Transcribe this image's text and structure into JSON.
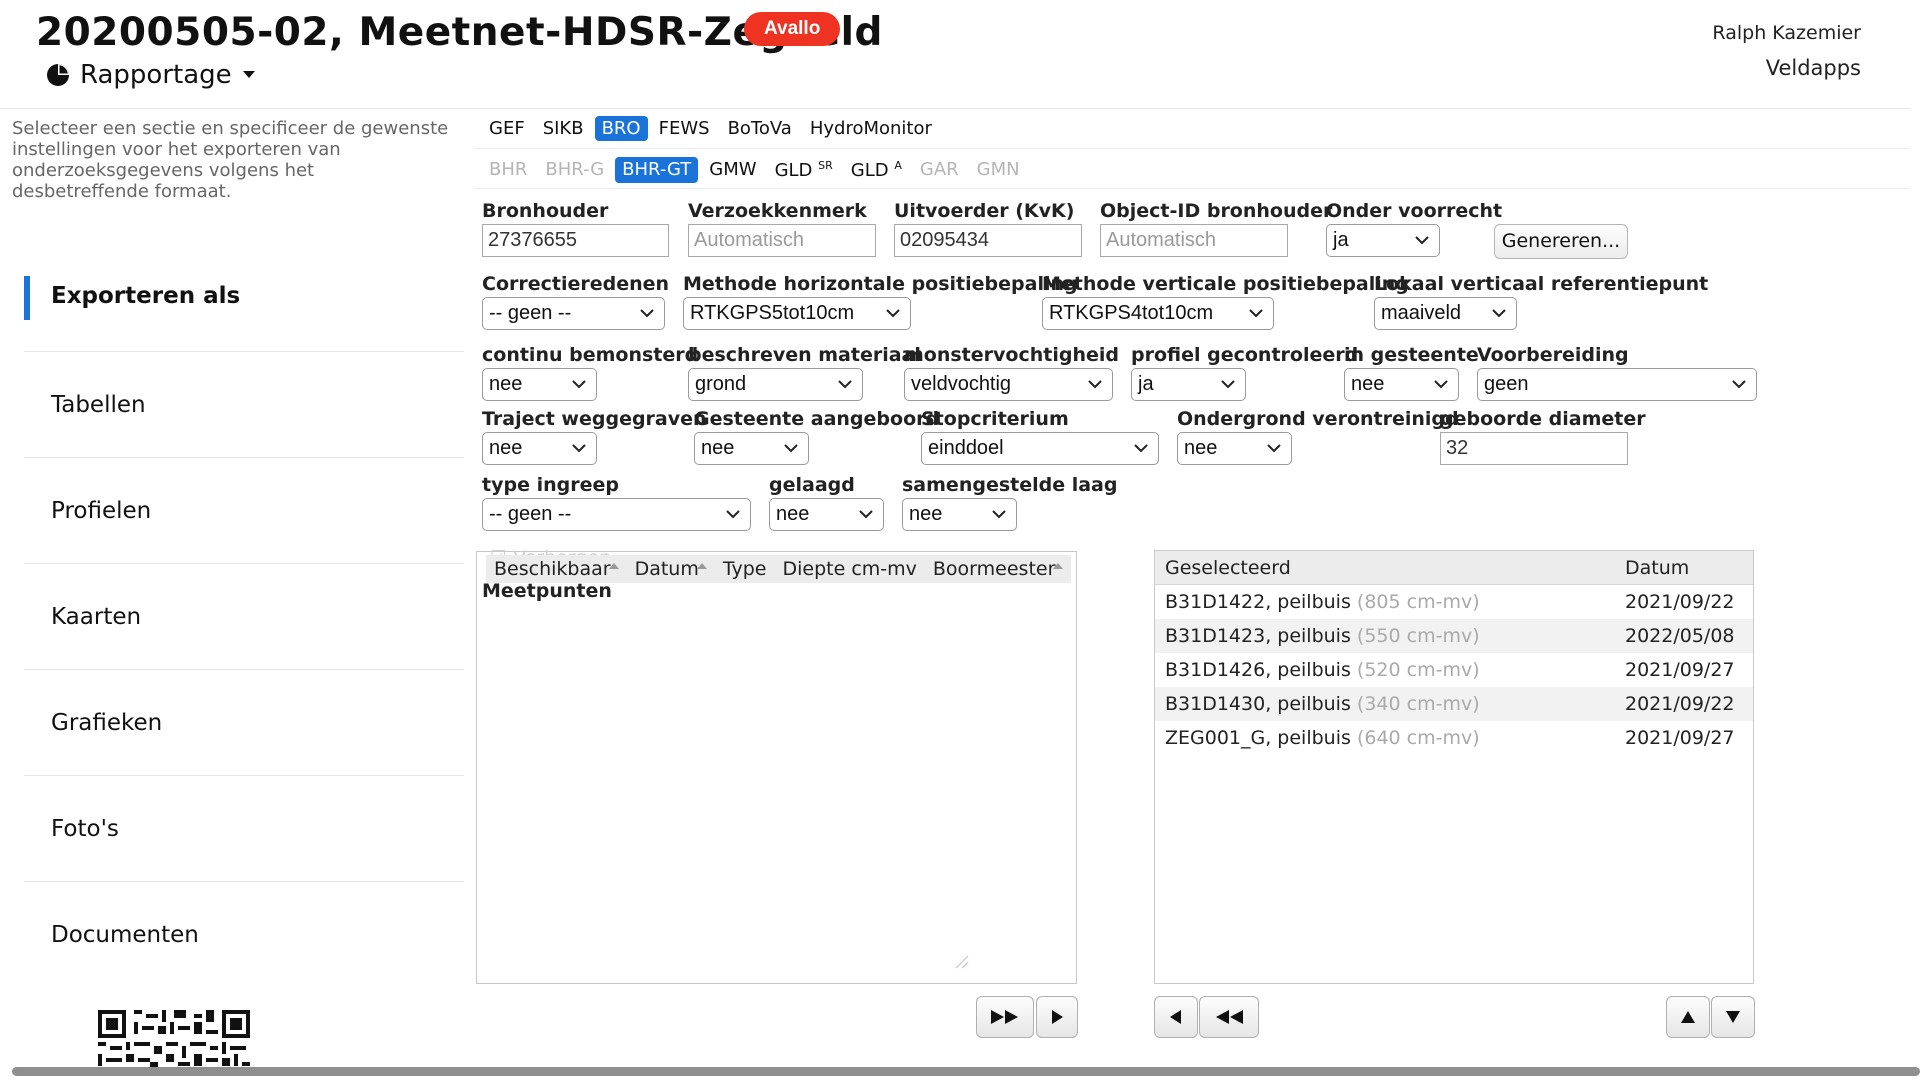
{
  "header": {
    "title": "20200505-02, Meetnet-HDSR-Zegveld",
    "badge": "Avallo",
    "menu_label": "Rapportage",
    "user": "Ralph Kazemier",
    "app": "Veldapps"
  },
  "sidebar": {
    "intro": "Selecteer een sectie en specificeer de gewenste instellingen voor het exporteren van onderzoeksgegevens volgens het desbetreffende formaat.",
    "items": [
      {
        "label": "Exporteren als",
        "active": true
      },
      {
        "label": "Tabellen"
      },
      {
        "label": "Profielen"
      },
      {
        "label": "Kaarten"
      },
      {
        "label": "Grafieken"
      },
      {
        "label": "Foto's"
      },
      {
        "label": "Documenten"
      }
    ]
  },
  "tabs": {
    "formats": [
      "GEF",
      "SIKB",
      "BRO",
      "FEWS",
      "BoToVa",
      "HydroMonitor"
    ],
    "active_format": "BRO",
    "subtypes": [
      "BHR",
      "BHR-G",
      "BHR-GT",
      "GMW",
      "GLD",
      "GLD",
      "GAR",
      "GMN"
    ],
    "subtype_sup": [
      "SR",
      "A"
    ],
    "active_subtype": "BHR-GT"
  },
  "form": {
    "bronhouder": {
      "label": "Bronhouder",
      "value": "27376655"
    },
    "verzoekkenmerk": {
      "label": "Verzoekkenmerk",
      "placeholder": "Automatisch"
    },
    "uitvoerder": {
      "label": "Uitvoerder (KvK)",
      "value": "02095434"
    },
    "object_id": {
      "label": "Object-ID bronhouder",
      "placeholder": "Automatisch"
    },
    "onder_voorrecht": {
      "label": "Onder voorrecht",
      "value": "ja"
    },
    "generate_button": "Genereren...",
    "correctieredenen": {
      "label": "Correctieredenen",
      "value": "-- geen --"
    },
    "methode_horizontaal": {
      "label": "Methode horizontale positiebepaling",
      "value": "RTKGPS5tot10cm"
    },
    "methode_verticaal": {
      "label": "Methode verticale positiebepaling",
      "value": "RTKGPS4tot10cm"
    },
    "lokaal_referentiepunt": {
      "label": "Lokaal verticaal referentiepunt",
      "value": "maaiveld"
    },
    "continu_bemonsterd": {
      "label": "continu bemonsterd",
      "value": "nee"
    },
    "beschreven_materiaal": {
      "label": "beschreven materiaal",
      "value": "grond"
    },
    "monstervochtigheid": {
      "label": "monstervochtigheid",
      "value": "veldvochtig"
    },
    "profiel_gecontroleerd": {
      "label": "profiel gecontroleerd",
      "value": "ja"
    },
    "in_gesteente": {
      "label": "in gesteente",
      "value": "nee"
    },
    "voorbereiding": {
      "label": "Voorbereiding",
      "value": "geen"
    },
    "traject_weggegraven": {
      "label": "Traject weggegraven",
      "value": "nee"
    },
    "gesteente_aangeboord": {
      "label": "Gesteente aangeboord",
      "value": "nee"
    },
    "stopcriterium": {
      "label": "Stopcriterium",
      "value": "einddoel"
    },
    "ondergrond_verontreinigd": {
      "label": "Ondergrond verontreinigd",
      "value": "nee"
    },
    "geboorde_diameter": {
      "label": "geboorde diameter",
      "value": "32"
    },
    "type_ingreep": {
      "label": "type ingreep",
      "value": "-- geen --"
    },
    "gelaagd": {
      "label": "gelaagd",
      "value": "nee"
    },
    "samengestelde_laag": {
      "label": "samengestelde laag",
      "value": "nee"
    }
  },
  "available_list": {
    "ghost_checkbox_label": "Verbergen",
    "columns": [
      "Beschikbaar",
      "Datum",
      "Type",
      "Diepte cm-mv",
      "Boormeester"
    ],
    "group_label": "Meetpunten"
  },
  "selected_list": {
    "columns": [
      "Geselecteerd",
      "Datum"
    ],
    "rows": [
      {
        "name": "B31D1422, peilbuis",
        "depth": "(805 cm-mv)",
        "date": "2021/09/22"
      },
      {
        "name": "B31D1423, peilbuis",
        "depth": "(550 cm-mv)",
        "date": "2022/05/08"
      },
      {
        "name": "B31D1426, peilbuis",
        "depth": "(520 cm-mv)",
        "date": "2021/09/27"
      },
      {
        "name": "B31D1430, peilbuis",
        "depth": "(340 cm-mv)",
        "date": "2021/09/22"
      },
      {
        "name": "ZEG001_G, peilbuis",
        "depth": "(640 cm-mv)",
        "date": "2021/09/27"
      }
    ]
  },
  "colors": {
    "accent": "#1a73d9",
    "badge": "#ee3322"
  }
}
